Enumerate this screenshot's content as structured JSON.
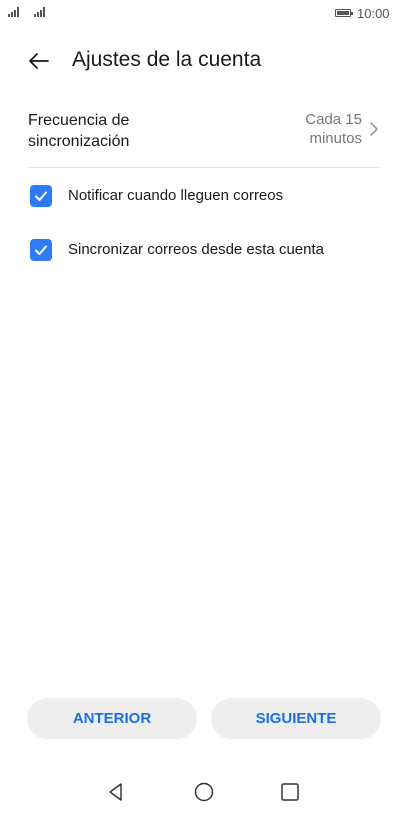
{
  "status_bar": {
    "time": "10:00",
    "icons": [
      "signal-icon",
      "signal-icon",
      "battery-icon"
    ]
  },
  "header": {
    "back_icon": "back-arrow-icon",
    "title": "Ajustes de la cuenta"
  },
  "sync_frequency": {
    "label": "Frecuencia de\nsincronización",
    "value": "Cada 15\nminutos",
    "icon": "chevron-right-icon"
  },
  "options": [
    {
      "label": "Notificar cuando lleguen correos",
      "checked": true
    },
    {
      "label": "Sincronizar correos desde esta cuenta",
      "checked": true
    }
  ],
  "buttons": {
    "previous": "ANTERIOR",
    "next": "SIGUIENTE"
  },
  "colors": {
    "accent": "#2f7bf5",
    "button_text": "#1b6fe6",
    "button_bg": "#eeeeee"
  },
  "nav_bar": {
    "icons": [
      "nav-back-icon",
      "nav-home-icon",
      "nav-recents-icon"
    ]
  }
}
